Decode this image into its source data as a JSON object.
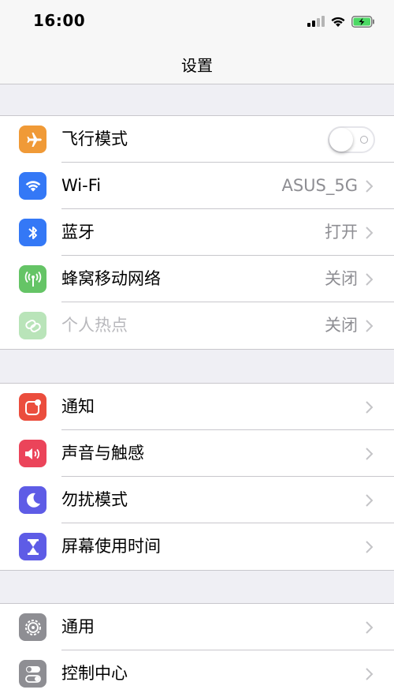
{
  "status": {
    "time": "16:00"
  },
  "nav": {
    "title": "设置"
  },
  "group1": [
    {
      "label": "飞行模式",
      "value": "",
      "icon": "airplane-icon",
      "color": "#f09a37",
      "toggle": true,
      "toggle_on": false
    },
    {
      "label": "Wi-Fi",
      "value": "ASUS_5G",
      "icon": "wifi-icon",
      "color": "#3478f6"
    },
    {
      "label": "蓝牙",
      "value": "打开",
      "icon": "bluetooth-icon",
      "color": "#3478f6"
    },
    {
      "label": "蜂窝移动网络",
      "value": "关闭",
      "icon": "cellular-antenna-icon",
      "color": "#65c466"
    },
    {
      "label": "个人热点",
      "value": "关闭",
      "icon": "hotspot-link-icon",
      "color": "#65c466",
      "disabled": true
    }
  ],
  "group2": [
    {
      "label": "通知",
      "icon": "notifications-icon",
      "color": "#eb4d3d"
    },
    {
      "label": "声音与触感",
      "icon": "speaker-icon",
      "color": "#eb445a"
    },
    {
      "label": "勿扰模式",
      "icon": "moon-icon",
      "color": "#5e5ce6"
    },
    {
      "label": "屏幕使用时间",
      "icon": "hourglass-icon",
      "color": "#5e5ce6"
    }
  ],
  "group3": [
    {
      "label": "通用",
      "icon": "gear-icon",
      "color": "#8e8e93"
    },
    {
      "label": "控制中心",
      "icon": "toggles-icon",
      "color": "#8e8e93"
    }
  ]
}
